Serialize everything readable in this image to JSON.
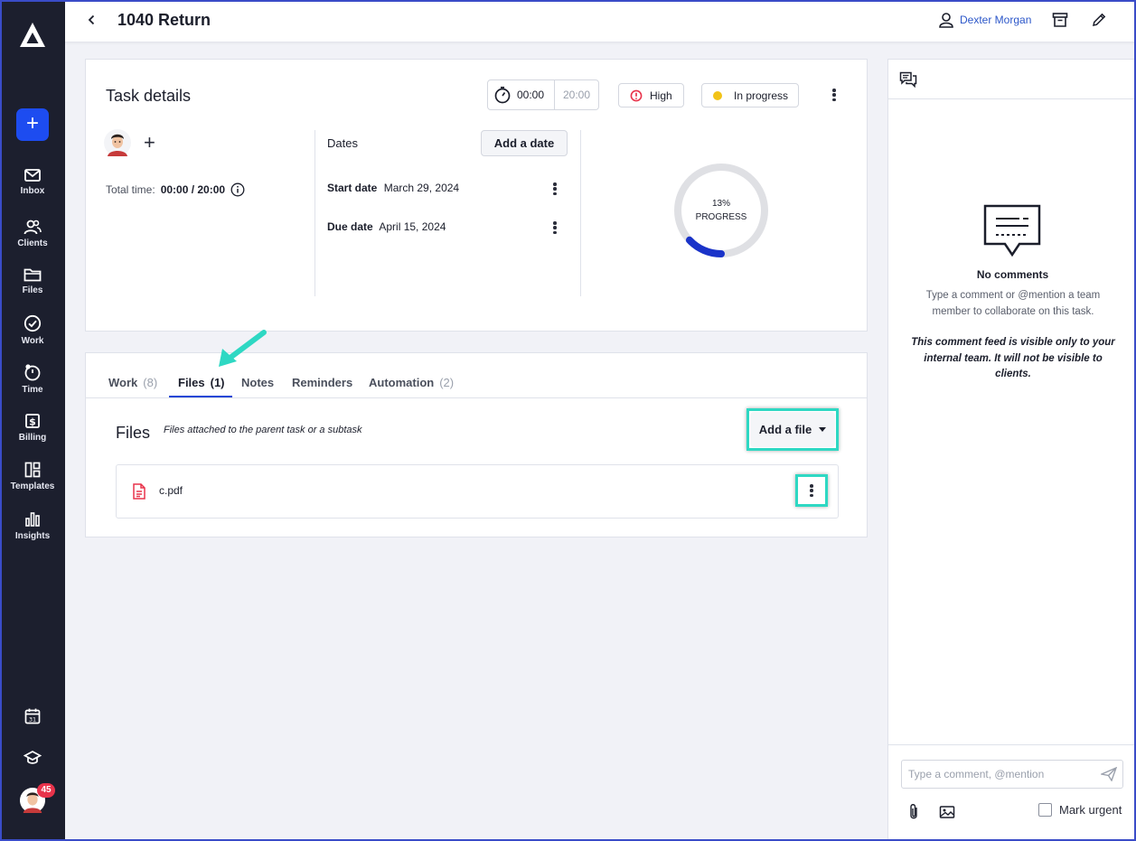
{
  "header": {
    "title": "1040 Return",
    "user_name": "Dexter Morgan"
  },
  "sidebar": {
    "items": [
      {
        "label": "Inbox"
      },
      {
        "label": "Clients"
      },
      {
        "label": "Files"
      },
      {
        "label": "Work"
      },
      {
        "label": "Time"
      },
      {
        "label": "Billing"
      },
      {
        "label": "Templates"
      },
      {
        "label": "Insights"
      }
    ],
    "notification_count": "45"
  },
  "task_details": {
    "title": "Task details",
    "timer_elapsed": "00:00",
    "timer_budget": "20:00",
    "priority": "High",
    "status": "In progress",
    "total_time_label": "Total time:",
    "total_time_value": "00:00 / 20:00",
    "dates_label": "Dates",
    "add_date_label": "Add a date",
    "start_date_label": "Start date",
    "start_date": "March 29, 2024",
    "due_date_label": "Due date",
    "due_date": "April 15, 2024",
    "progress_percent": "13%",
    "progress_label": "PROGRESS",
    "progress_fraction": 0.13
  },
  "tabs": [
    {
      "label": "Work",
      "count": "(8)"
    },
    {
      "label": "Files",
      "count": "(1)"
    },
    {
      "label": "Notes",
      "count": ""
    },
    {
      "label": "Reminders",
      "count": ""
    },
    {
      "label": "Automation",
      "count": "(2)"
    }
  ],
  "files_section": {
    "heading": "Files",
    "subtitle": "Files attached to the parent task or a subtask",
    "add_file_label": "Add a file",
    "files": [
      {
        "name": "c.pdf"
      }
    ]
  },
  "comments": {
    "empty_title": "No comments",
    "empty_desc": "Type a comment or @mention a team member to collaborate on this task.",
    "visibility_note": "This comment feed is visible only to your internal team. It will not be visible to clients.",
    "input_placeholder": "Type a comment, @mention",
    "mark_urgent_label": "Mark urgent"
  },
  "colors": {
    "sidebar_bg": "#1c1f2e",
    "accent": "#1d4cf0",
    "highlight": "#2ed8c3",
    "status_dot": "#f2c318",
    "priority_red": "#e8334b"
  }
}
